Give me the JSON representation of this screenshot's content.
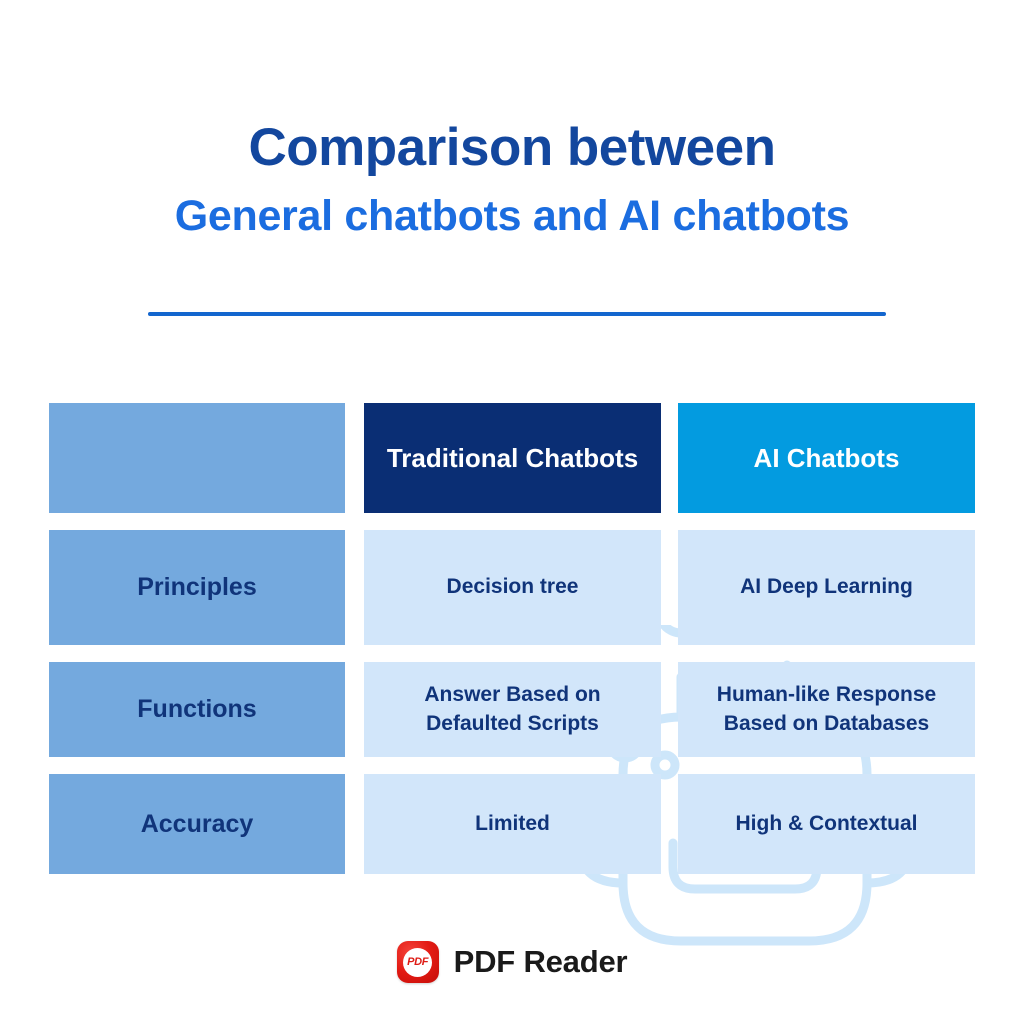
{
  "title": {
    "line1": "Comparison between",
    "line2": "General chatbots and AI chatbots"
  },
  "colors": {
    "title_line1": "#13479E",
    "title_line2": "#1B6DE0",
    "divider": "#1366CE",
    "label_cell_bg": "#74A9DE",
    "header_traditional_bg": "#0A2E74",
    "header_ai_bg": "#039BE0",
    "value_cell_bg": "#D2E6FA",
    "cell_text": "#10347A",
    "header_text": "#FFFFFF",
    "watermark": "#CDE6FA",
    "logo_red": "#DE1B14"
  },
  "table": {
    "header": {
      "blank": "",
      "traditional": "Traditional Chatbots",
      "ai": "AI Chatbots"
    },
    "rows": [
      {
        "label": "Principles",
        "traditional": "Decision tree",
        "ai": "AI Deep Learning"
      },
      {
        "label": "Functions",
        "traditional": "Answer Based on Defaulted Scripts",
        "ai": "Human-like Response Based on Databases"
      },
      {
        "label": "Accuracy",
        "traditional": "Limited",
        "ai": "High & Contextual"
      }
    ]
  },
  "footer": {
    "badge_text": "PDF",
    "brand": "PDF Reader"
  },
  "watermark": {
    "icon": "robot-face-icon"
  }
}
